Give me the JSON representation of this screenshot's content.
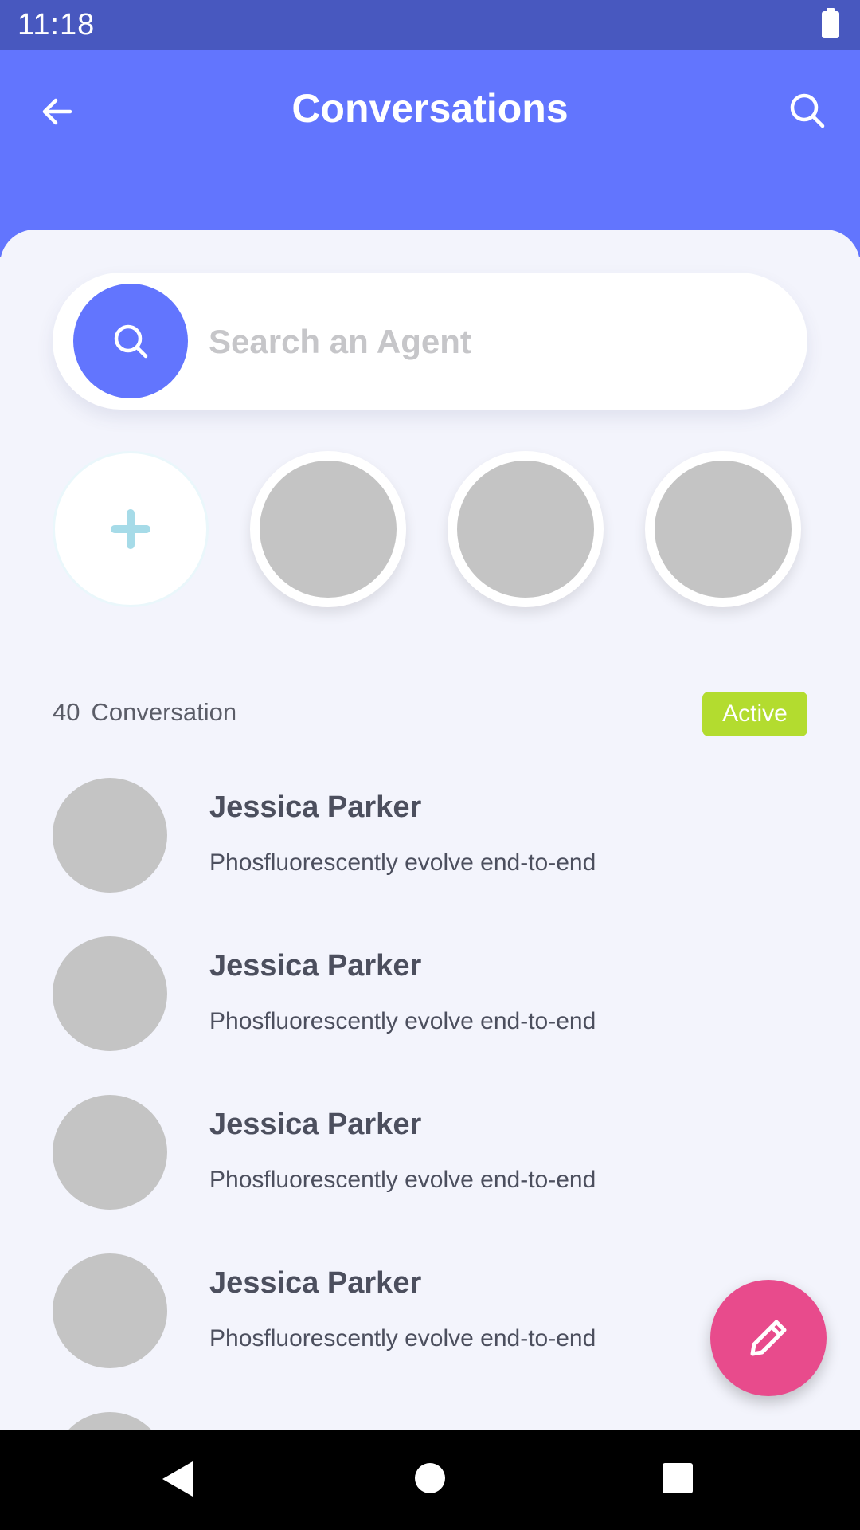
{
  "status_bar": {
    "time": "11:18"
  },
  "header": {
    "title": "Conversations",
    "back_icon": "arrow-left-icon",
    "search_icon": "search-icon"
  },
  "search": {
    "placeholder": "Search an Agent",
    "value": ""
  },
  "agents": {
    "add_icon": "plus-icon",
    "count_visible": 3
  },
  "conversations": {
    "count": "40",
    "label": "Conversation",
    "status_badge": "Active",
    "items": [
      {
        "name": "Jessica Parker",
        "message": "Phosfluorescently evolve end-to-end"
      },
      {
        "name": "Jessica Parker",
        "message": "Phosfluorescently evolve end-to-end"
      },
      {
        "name": "Jessica Parker",
        "message": "Phosfluorescently evolve end-to-end"
      },
      {
        "name": "Jessica Parker",
        "message": "Phosfluorescently evolve end-to-end"
      }
    ]
  },
  "fab": {
    "icon": "pencil-icon"
  },
  "colors": {
    "status_bar": "#4858bf",
    "header": "#6275fe",
    "background": "#f3f4fc",
    "badge": "#b3dc2f",
    "fab": "#e84b8c",
    "avatar_placeholder": "#c4c4c4",
    "plus": "#a6dbe8"
  }
}
